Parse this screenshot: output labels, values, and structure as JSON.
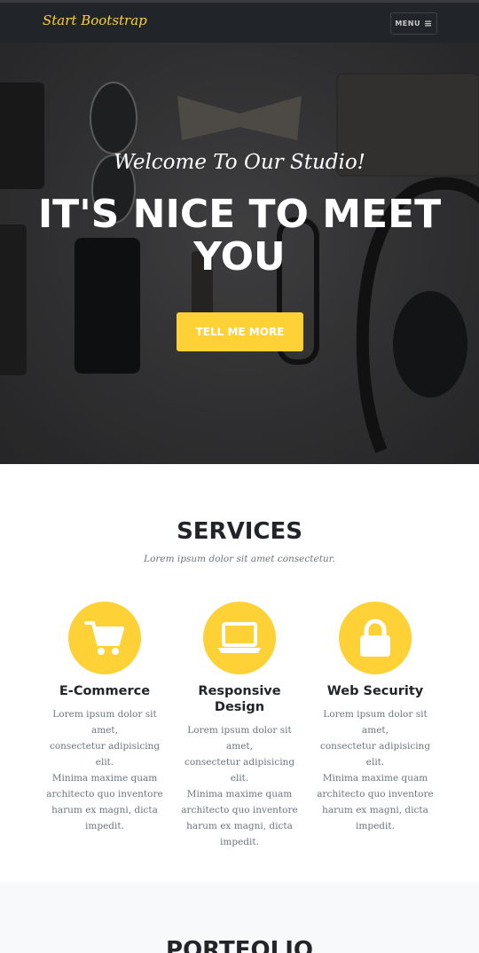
{
  "navbar": {
    "brand": "Start Bootstrap",
    "menu_label": "MENU",
    "menu_icon": "hamburger-icon"
  },
  "hero": {
    "subheading": "Welcome To Our Studio!",
    "heading_line1": "IT'S NICE TO MEET",
    "heading_line2": "YOU",
    "cta_label": "TELL ME MORE"
  },
  "services": {
    "title": "SERVICES",
    "subtitle": "Lorem ipsum dolor sit amet consectetur.",
    "items": [
      {
        "icon": "shopping-cart-icon",
        "title": "E-Commerce",
        "lines": [
          "Lorem ipsum dolor sit amet,",
          "consectetur adipisicing elit.",
          "Minima maxime quam",
          "architecto quo inventore",
          "harum ex magni, dicta",
          "impedit."
        ]
      },
      {
        "icon": "laptop-icon",
        "title_line1": "Responsive",
        "title_line2": "Design",
        "lines": [
          "Lorem ipsum dolor sit amet,",
          "consectetur adipisicing elit.",
          "Minima maxime quam",
          "architecto quo inventore",
          "harum ex magni, dicta",
          "impedit."
        ]
      },
      {
        "icon": "lock-icon",
        "title": "Web Security",
        "lines": [
          "Lorem ipsum dolor sit amet,",
          "consectetur adipisicing elit.",
          "Minima maxime quam",
          "architecto quo inventore",
          "harum ex magni, dicta",
          "impedit."
        ]
      }
    ]
  },
  "portfolio": {
    "title": "PORTFOLIO"
  },
  "colors": {
    "accent": "#fed136",
    "nav_bg": "#212529",
    "text_dark": "#212529",
    "text_muted": "#6c757d"
  }
}
